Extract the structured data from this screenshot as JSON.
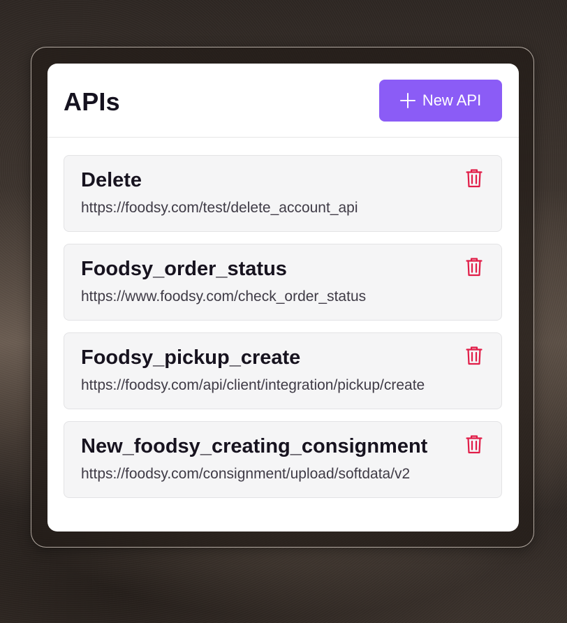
{
  "panel": {
    "title": "APIs",
    "new_button_label": "New API",
    "new_button_icon": "plus-icon"
  },
  "apis": [
    {
      "name": "Delete",
      "url": "https://foodsy.com/test/delete_account_api",
      "delete_icon": "trash-icon"
    },
    {
      "name": "Foodsy_order_status",
      "url": "https://www.foodsy.com/check_order_status",
      "delete_icon": "trash-icon"
    },
    {
      "name": "Foodsy_pickup_create",
      "url": "https://foodsy.com/api/client/integration/pickup/create",
      "delete_icon": "trash-icon"
    },
    {
      "name": "New_foodsy_creating_consignment",
      "url": "https://foodsy.com/consignment/upload/softdata/v2",
      "delete_icon": "trash-icon"
    }
  ],
  "colors": {
    "accent": "#8b5cf6",
    "danger": "#e11d48",
    "card_bg": "#f5f5f6",
    "text": "#17131f"
  }
}
